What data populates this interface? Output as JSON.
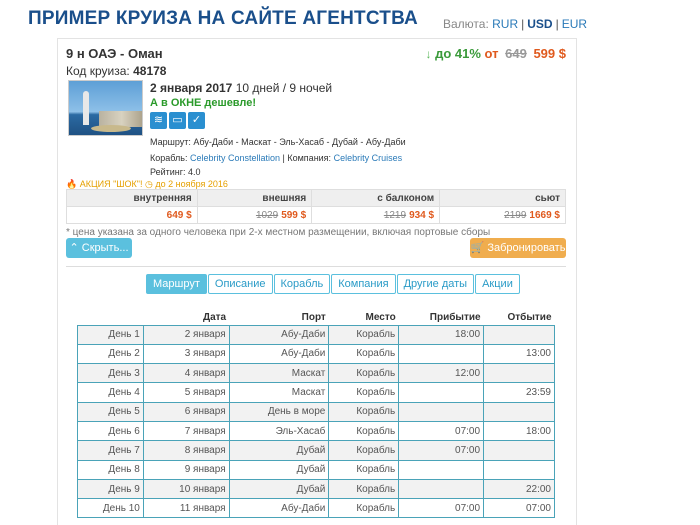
{
  "page": {
    "title": "ПРИМЕР КРУИЗА НА САЙТЕ АГЕНТСТВА"
  },
  "currency": {
    "label": "Валюта:",
    "options": [
      "RUR",
      "USD",
      "EUR"
    ],
    "selected": "USD"
  },
  "cruise": {
    "name": "9 н ОАЭ - Оман",
    "discount_arrow": "↓",
    "discount_pct": "до 41%",
    "discount_from": "от",
    "old_price": "649",
    "new_price": "599 $",
    "code_label": "Код круиза:",
    "code": "48178",
    "date": "2 января 2017",
    "duration": "10 дней / 9 ночей",
    "okno": "А в ОКНЕ дешевле!",
    "route": "Маршрут: Абу-Даби - Маскат - Эль-Хасаб - Дубай - Абу-Даби",
    "ship_label": "Корабль:",
    "ship": "Celebrity Constellation",
    "company_label": "Компания:",
    "company": "Celebrity Cruises",
    "rating": "Рейтинг: 4.0",
    "promo": "АКЦИЯ \"ШОК\"! ◷ до 2 ноября 2016"
  },
  "prices": {
    "headers": [
      "внутренняя",
      "внешняя",
      "с балконом",
      "сьют"
    ],
    "cells": [
      {
        "old": "",
        "new": "649 $"
      },
      {
        "old": "1029",
        "new": "599 $"
      },
      {
        "old": "1219",
        "new": "934 $"
      },
      {
        "old": "2199",
        "new": "1669 $"
      }
    ]
  },
  "note": "* цена указана за одного человека при 2-х местном размещении, включая портовые сборы",
  "buttons": {
    "hide": "Скрыть...",
    "book": "Забронировать"
  },
  "tabs": [
    "Маршрут",
    "Описание",
    "Корабль",
    "Компания",
    "Другие даты",
    "Акции"
  ],
  "itinerary": {
    "headers": [
      "",
      "Дата",
      "Порт",
      "Место",
      "Прибытие",
      "Отбытие"
    ],
    "rows": [
      [
        "День 1",
        "2 января",
        "Абу-Даби",
        "Корабль",
        "18:00",
        ""
      ],
      [
        "День 2",
        "3 января",
        "Абу-Даби",
        "Корабль",
        "",
        "13:00"
      ],
      [
        "День 3",
        "4 января",
        "Маскат",
        "Корабль",
        "12:00",
        ""
      ],
      [
        "День 4",
        "5 января",
        "Маскат",
        "Корабль",
        "",
        "23:59"
      ],
      [
        "День 5",
        "6 января",
        "День в море",
        "Корабль",
        "",
        ""
      ],
      [
        "День 6",
        "7 января",
        "Эль-Хасаб",
        "Корабль",
        "07:00",
        "18:00"
      ],
      [
        "День 7",
        "8 января",
        "Дубай",
        "Корабль",
        "07:00",
        ""
      ],
      [
        "День 8",
        "9 января",
        "Дубай",
        "Корабль",
        "",
        ""
      ],
      [
        "День 9",
        "10 января",
        "Дубай",
        "Корабль",
        "",
        "22:00"
      ],
      [
        "День 10",
        "11 января",
        "Абу-Даби",
        "Корабль",
        "07:00",
        "07:00"
      ]
    ]
  }
}
